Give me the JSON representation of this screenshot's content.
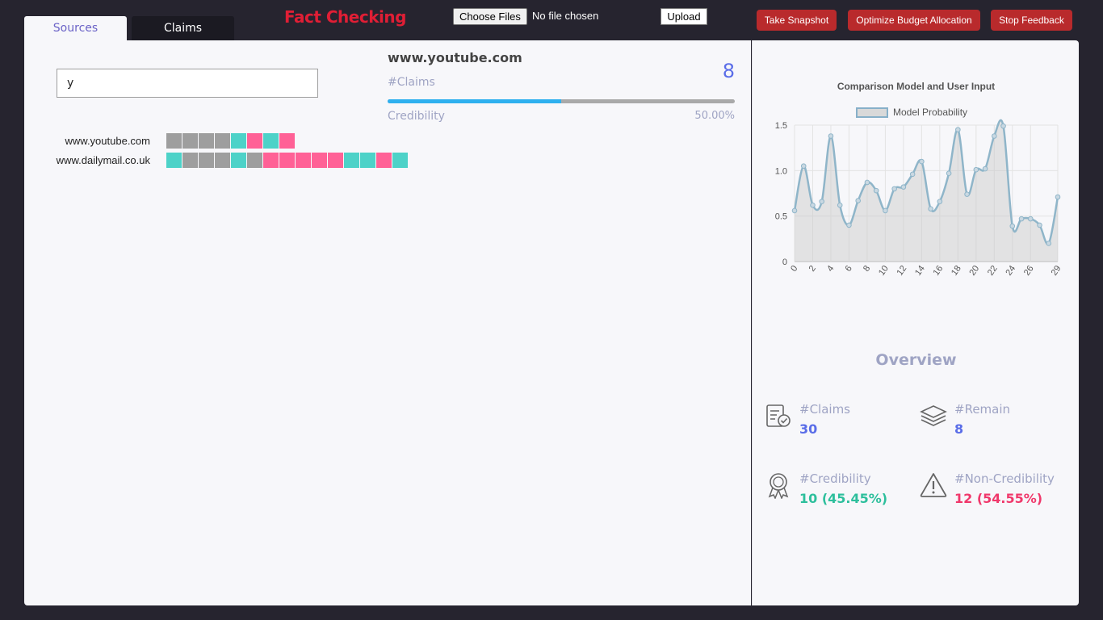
{
  "tabs": {
    "sources": "Sources",
    "claims": "Claims"
  },
  "app_title": "Fact Checking",
  "file_input": {
    "button_label": "Choose Files",
    "status": "No file chosen"
  },
  "upload_label": "Upload",
  "actions": {
    "snapshot": "Take Snapshot",
    "optimize": "Optimize Budget Allocation",
    "stop": "Stop Feedback"
  },
  "colors": {
    "gray": "#9e9e9e",
    "teal": "#4dd2c8",
    "pink": "#ff6196",
    "accent": "#5a6de8",
    "brand_red": "#e01e35"
  },
  "search": {
    "value": "y"
  },
  "sources": [
    {
      "name": "www.youtube.com",
      "cells": [
        "gray",
        "gray",
        "gray",
        "gray",
        "teal",
        "pink",
        "teal",
        "pink"
      ]
    },
    {
      "name": "www.dailymail.co.uk",
      "cells": [
        "teal",
        "gray",
        "gray",
        "gray",
        "teal",
        "gray",
        "pink",
        "pink",
        "pink",
        "pink",
        "pink",
        "teal",
        "teal",
        "pink",
        "teal"
      ]
    }
  ],
  "detail": {
    "source": "www.youtube.com",
    "claims_label": "#Claims",
    "claims_count": "8",
    "credibility_label": "Credibility",
    "credibility_pct": "50.00%",
    "credibility_value": 0.5
  },
  "chart_data": {
    "type": "area",
    "title": "Comparison Model and User Input",
    "series": [
      {
        "name": "Model Probability",
        "values": [
          0.56,
          1.05,
          0.62,
          0.66,
          1.38,
          0.62,
          0.4,
          0.67,
          0.87,
          0.78,
          0.56,
          0.8,
          0.82,
          0.96,
          1.1,
          0.58,
          0.66,
          0.97,
          1.45,
          0.74,
          1.01,
          1.02,
          1.38,
          1.49,
          0.39,
          0.47,
          0.47,
          0.4,
          0.2,
          0.71
        ]
      }
    ],
    "x": [
      0,
      1,
      2,
      3,
      4,
      5,
      6,
      7,
      8,
      9,
      10,
      11,
      12,
      13,
      14,
      15,
      16,
      17,
      18,
      19,
      20,
      21,
      22,
      23,
      24,
      25,
      26,
      27,
      28,
      29
    ],
    "x_tick_labels": [
      "0",
      "2",
      "4",
      "6",
      "8",
      "10",
      "12",
      "14",
      "16",
      "18",
      "20",
      "22",
      "24",
      "26",
      "29"
    ],
    "y_tick_labels": [
      "0",
      "0.5",
      "1.0",
      "1.5"
    ],
    "ylim": [
      0,
      1.5
    ],
    "legend": "top",
    "grid": true
  },
  "overview": {
    "title": "Overview",
    "claims": {
      "label": "#Claims",
      "value": "30",
      "icon": "claims-check-icon"
    },
    "remain": {
      "label": "#Remain",
      "value": "8",
      "icon": "layers-icon"
    },
    "credibility": {
      "label": "#Credibility",
      "value": "10 (45.45%)",
      "icon": "award-badge-icon",
      "color": "#2dbf9c"
    },
    "noncredibility": {
      "label": "#Non-Credibility",
      "value": "12 (54.55%)",
      "icon": "warning-icon",
      "color": "#f0386b"
    }
  }
}
